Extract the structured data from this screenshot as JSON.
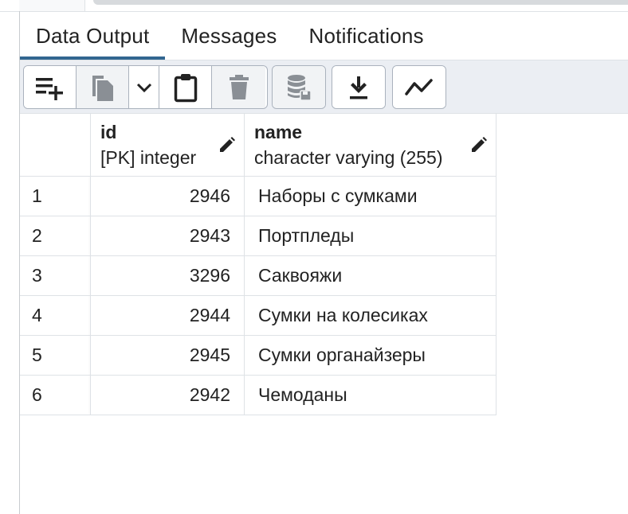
{
  "tabs": [
    {
      "label": "Data Output",
      "active": true
    },
    {
      "label": "Messages",
      "active": false
    },
    {
      "label": "Notifications",
      "active": false
    }
  ],
  "toolbar": {
    "buttons": [
      {
        "icon": "add-row-icon",
        "enabled": true
      },
      {
        "icon": "copy-icon",
        "enabled": false
      },
      {
        "icon": "chevron-down-icon",
        "enabled": true
      },
      {
        "icon": "paste-icon",
        "enabled": true
      },
      {
        "icon": "delete-icon",
        "enabled": false
      },
      {
        "icon": "save-data-icon",
        "enabled": false
      },
      {
        "icon": "download-icon",
        "enabled": true
      },
      {
        "icon": "graph-visualiser-icon",
        "enabled": true
      }
    ]
  },
  "grid": {
    "columns": [
      {
        "name": "id",
        "type": "[PK] integer"
      },
      {
        "name": "name",
        "type": "character varying (255)"
      }
    ],
    "rows": [
      {
        "n": "1",
        "id": "2946",
        "name": "Наборы с сумками"
      },
      {
        "n": "2",
        "id": "2943",
        "name": "Портпледы"
      },
      {
        "n": "3",
        "id": "3296",
        "name": "Саквояжи"
      },
      {
        "n": "4",
        "id": "2944",
        "name": "Сумки на колесиках"
      },
      {
        "n": "5",
        "id": "2945",
        "name": "Сумки органайзеры"
      },
      {
        "n": "6",
        "id": "2942",
        "name": "Чемоданы"
      }
    ]
  },
  "colors": {
    "accent": "#326690",
    "toolbar_bg": "#ebeef3",
    "border": "#dee2e6"
  }
}
